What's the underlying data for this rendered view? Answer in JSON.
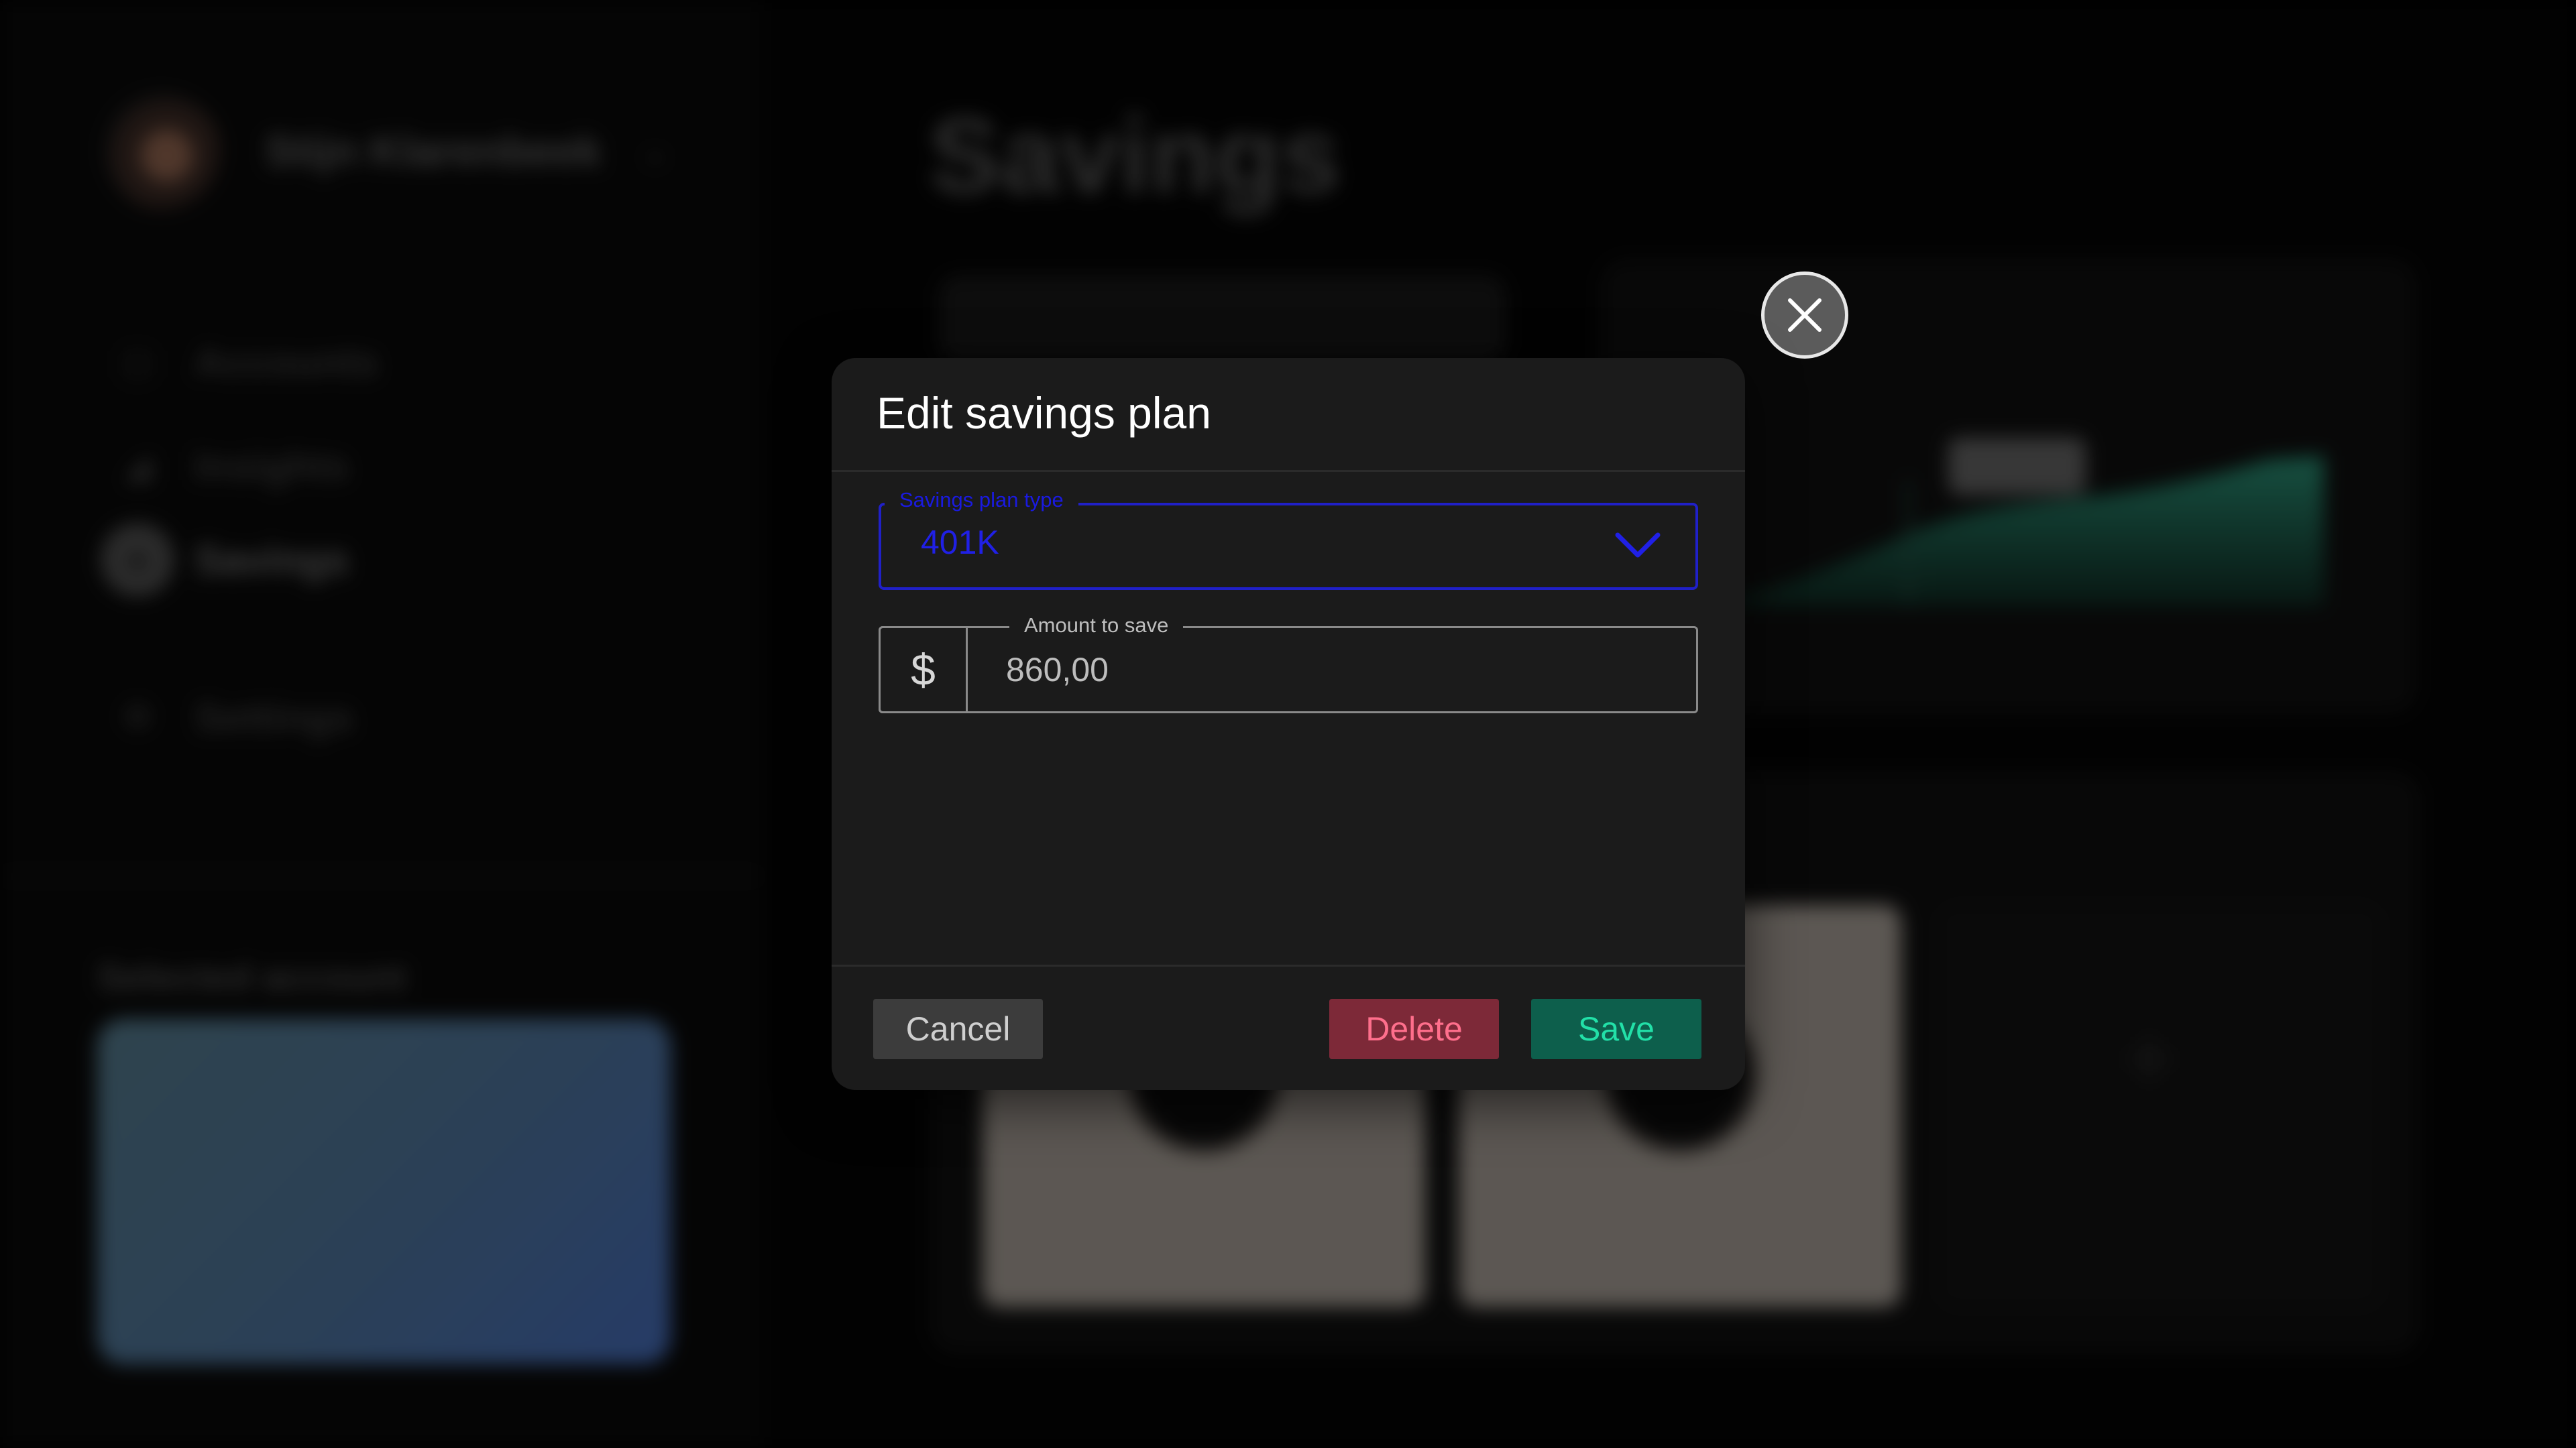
{
  "background": {
    "user": {
      "name": "Stijn Klarenbeek"
    },
    "nav": [
      {
        "label": "Accounts",
        "icon": "wallet-icon"
      },
      {
        "label": "Insights",
        "icon": "chart-icon"
      },
      {
        "label": "Savings",
        "icon": "piggy-bank-icon",
        "active": true
      },
      {
        "label": "Settings",
        "icon": "gear-icon"
      }
    ],
    "page_title": "Savings",
    "selected_account_label": "Selected account"
  },
  "modal": {
    "title": "Edit savings plan",
    "savings_plan_type": {
      "label": "Savings plan type",
      "value": "401K"
    },
    "amount": {
      "label": "Amount to save",
      "currency_symbol": "$",
      "value": "860,00"
    },
    "buttons": {
      "cancel": "Cancel",
      "delete": "Delete",
      "save": "Save"
    }
  },
  "colors": {
    "accent_blue": "#2020e6",
    "delete_bg": "#7d2938",
    "delete_text": "#ff6f8c",
    "save_bg": "#0d5f4c",
    "save_text": "#22e0a8"
  }
}
